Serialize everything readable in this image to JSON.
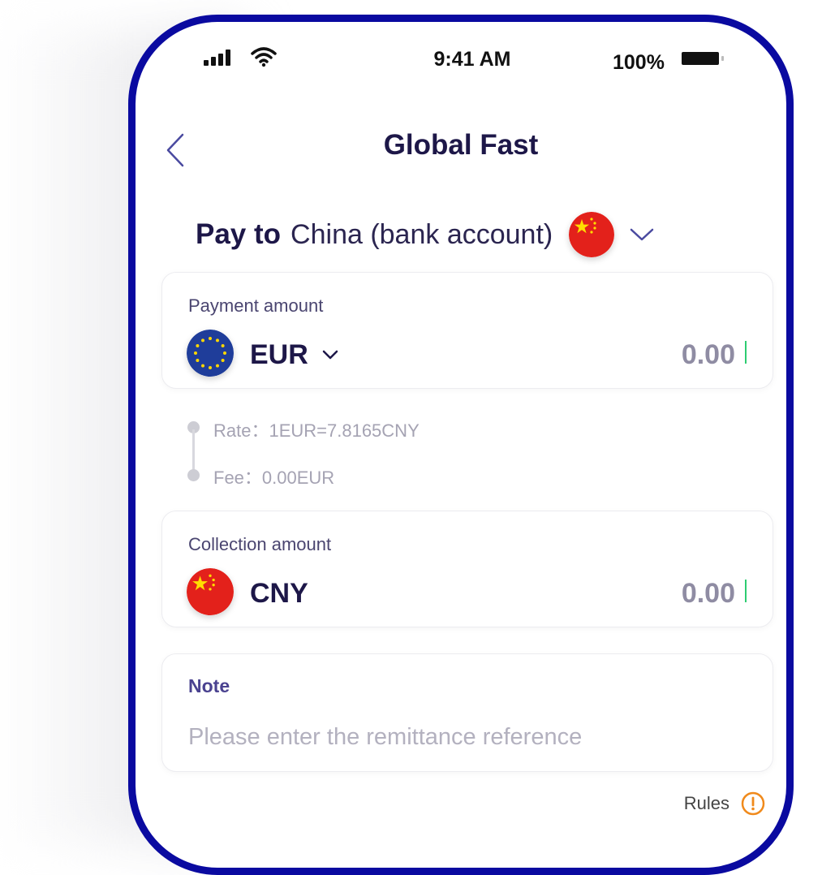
{
  "status": {
    "time": "9:41 AM",
    "battery_percent": "100%"
  },
  "header": {
    "title": "Global Fast"
  },
  "pay_to": {
    "label": "Pay to",
    "destination": "China (bank account)"
  },
  "payment": {
    "label": "Payment amount",
    "currency": "EUR",
    "amount": "0.00"
  },
  "details": {
    "rate": "Rate：1EUR=7.8165CNY",
    "fee": "Fee：0.00EUR"
  },
  "collection": {
    "label": "Collection amount",
    "currency": "CNY",
    "amount": "0.00"
  },
  "note": {
    "label": "Note",
    "placeholder": "Please enter the remittance reference"
  },
  "rules": {
    "label": "Rules"
  },
  "colors": {
    "frame": "#0a0aa0",
    "title": "#1d1748",
    "caret": "#2ecc71",
    "rules_icon": "#f08a1c"
  }
}
